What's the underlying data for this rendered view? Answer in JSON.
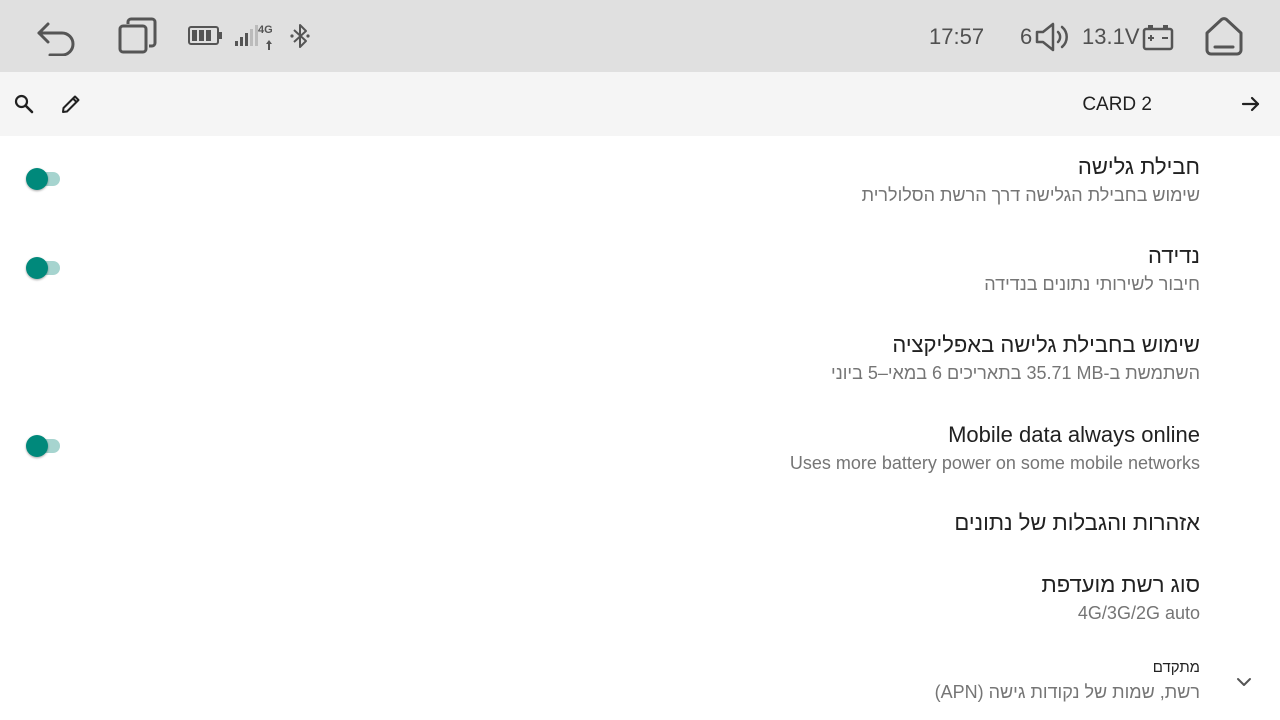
{
  "status_bar": {
    "back_icon": "back-arrow-icon",
    "recents_icon": "recents-icon",
    "battery_icon": "battery-icon",
    "network_type": "4G",
    "signal_icon": "signal-icon",
    "bluetooth_icon": "bluetooth-icon",
    "time": "17:57",
    "volume_level": "6",
    "volume_icon": "speaker-icon",
    "voltage": "13.1V",
    "car_battery_icon": "car-battery-icon",
    "home_icon": "home-icon"
  },
  "toolbar": {
    "search_icon": "search-icon",
    "edit_icon": "pencil-icon",
    "title": "CARD 2",
    "forward_icon": "arrow-right-icon"
  },
  "preferences": [
    {
      "title": "חבילת גלישה",
      "summary": "שימוש בחבילת הגלישה דרך הרשת הסלולרית",
      "switch_on": true
    },
    {
      "title": "נדידה",
      "summary": "חיבור לשירותי נתונים בנדידה",
      "switch_on": true
    },
    {
      "title": "שימוש בחבילת גלישה באפליקציה",
      "summary": "השתמשת ב-‎35.71 MB‏ בתאריכים 6 במאי–5 ביוני"
    },
    {
      "title": "Mobile data always online",
      "summary": "Uses more battery power on some mobile networks",
      "switch_on": true
    },
    {
      "title": "אזהרות והגבלות של נתונים"
    },
    {
      "title": "סוג רשת מועדפת",
      "summary": "4G/3G/2G auto"
    },
    {
      "title": "מתקדם",
      "summary": "רשת, שמות של נקודות גישה (APN)",
      "expand_icon": "chevron-down-icon"
    }
  ],
  "colors": {
    "accent": "#00897b",
    "switch_track": "#a6d4cf",
    "status_bar_bg": "#e0e0e0",
    "toolbar_bg": "#f5f5f5",
    "primary_text": "#212121",
    "secondary_text": "#757575"
  }
}
